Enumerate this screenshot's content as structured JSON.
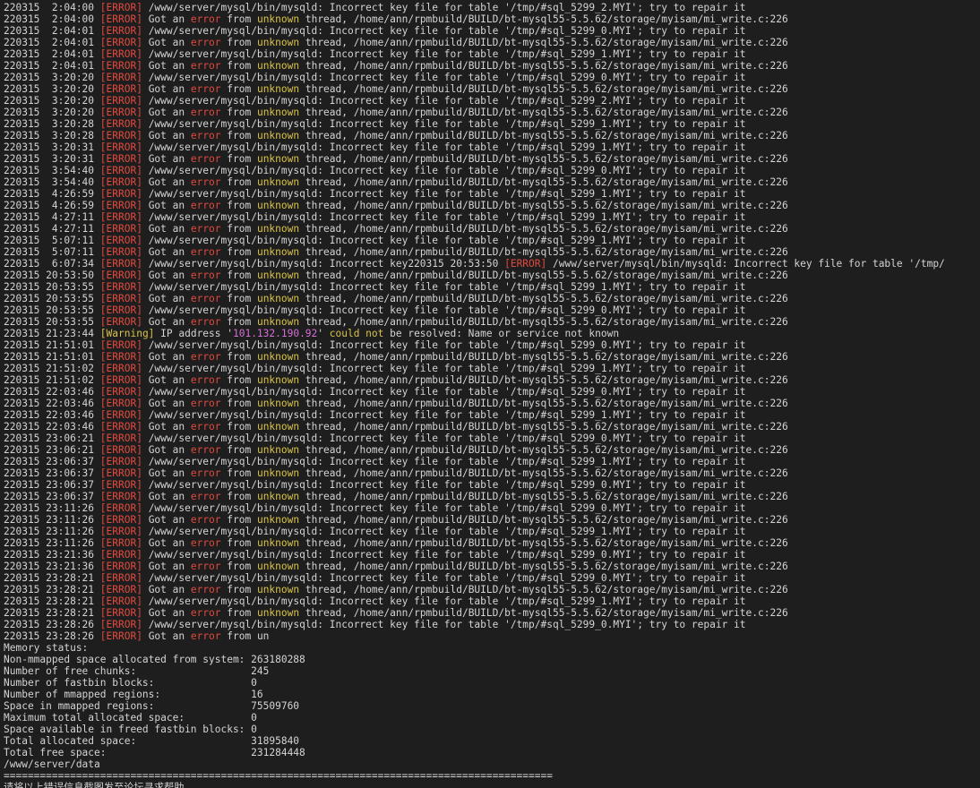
{
  "terminal": {
    "lines": [
      {
        "k": "inc",
        "ts": "220315  2:04:00",
        "tbl": "2"
      },
      {
        "k": "got",
        "ts": "220315  2:04:00"
      },
      {
        "k": "inc",
        "ts": "220315  2:04:01",
        "tbl": "0"
      },
      {
        "k": "got",
        "ts": "220315  2:04:01"
      },
      {
        "k": "inc",
        "ts": "220315  2:04:01",
        "tbl": "1"
      },
      {
        "k": "got",
        "ts": "220315  2:04:01"
      },
      {
        "k": "inc",
        "ts": "220315  3:20:20",
        "tbl": "0"
      },
      {
        "k": "got",
        "ts": "220315  3:20:20"
      },
      {
        "k": "inc",
        "ts": "220315  3:20:20",
        "tbl": "2"
      },
      {
        "k": "got",
        "ts": "220315  3:20:20"
      },
      {
        "k": "inc",
        "ts": "220315  3:20:28",
        "tbl": "1"
      },
      {
        "k": "got",
        "ts": "220315  3:20:28"
      },
      {
        "k": "inc",
        "ts": "220315  3:20:31",
        "tbl": "1"
      },
      {
        "k": "got",
        "ts": "220315  3:20:31"
      },
      {
        "k": "inc",
        "ts": "220315  3:54:40",
        "tbl": "0"
      },
      {
        "k": "got",
        "ts": "220315  3:54:40"
      },
      {
        "k": "inc",
        "ts": "220315  4:26:59",
        "tbl": "1"
      },
      {
        "k": "got",
        "ts": "220315  4:26:59"
      },
      {
        "k": "inc",
        "ts": "220315  4:27:11",
        "tbl": "1"
      },
      {
        "k": "got",
        "ts": "220315  4:27:11"
      },
      {
        "k": "inc",
        "ts": "220315  5:07:11",
        "tbl": "1"
      },
      {
        "k": "got",
        "ts": "220315  5:07:11"
      },
      {
        "k": "trunc",
        "ts": "220315  6:07:34"
      },
      {
        "k": "got",
        "ts": "220315 20:53:50"
      },
      {
        "k": "inc",
        "ts": "220315 20:53:55",
        "tbl": "1"
      },
      {
        "k": "got",
        "ts": "220315 20:53:55"
      },
      {
        "k": "inc",
        "ts": "220315 20:53:55",
        "tbl": "0"
      },
      {
        "k": "got",
        "ts": "220315 20:53:55"
      },
      {
        "k": "warn",
        "ts": "220315 21:23:44"
      },
      {
        "k": "inc",
        "ts": "220315 21:51:01",
        "tbl": "0"
      },
      {
        "k": "got",
        "ts": "220315 21:51:01"
      },
      {
        "k": "inc",
        "ts": "220315 21:51:02",
        "tbl": "1"
      },
      {
        "k": "got",
        "ts": "220315 21:51:02"
      },
      {
        "k": "inc",
        "ts": "220315 22:03:46",
        "tbl": "0"
      },
      {
        "k": "got",
        "ts": "220315 22:03:46"
      },
      {
        "k": "inc",
        "ts": "220315 22:03:46",
        "tbl": "1"
      },
      {
        "k": "got",
        "ts": "220315 22:03:46"
      },
      {
        "k": "inc",
        "ts": "220315 23:06:21",
        "tbl": "0"
      },
      {
        "k": "got",
        "ts": "220315 23:06:21"
      },
      {
        "k": "inc",
        "ts": "220315 23:06:37",
        "tbl": "1"
      },
      {
        "k": "got",
        "ts": "220315 23:06:37"
      },
      {
        "k": "inc",
        "ts": "220315 23:06:37",
        "tbl": "0"
      },
      {
        "k": "got",
        "ts": "220315 23:06:37"
      },
      {
        "k": "inc",
        "ts": "220315 23:11:26",
        "tbl": "0"
      },
      {
        "k": "got",
        "ts": "220315 23:11:26"
      },
      {
        "k": "inc",
        "ts": "220315 23:11:26",
        "tbl": "1"
      },
      {
        "k": "got",
        "ts": "220315 23:11:26"
      },
      {
        "k": "inc",
        "ts": "220315 23:21:36",
        "tbl": "0"
      },
      {
        "k": "got",
        "ts": "220315 23:21:36"
      },
      {
        "k": "inc",
        "ts": "220315 23:28:21",
        "tbl": "0"
      },
      {
        "k": "got",
        "ts": "220315 23:28:21"
      },
      {
        "k": "inc",
        "ts": "220315 23:28:21",
        "tbl": "1"
      },
      {
        "k": "got",
        "ts": "220315 23:28:21"
      },
      {
        "k": "inc",
        "ts": "220315 23:28:26",
        "tbl": "0"
      },
      {
        "k": "gotshort",
        "ts": "220315 23:28:26"
      },
      {
        "k": "plain",
        "text": "Memory status:"
      },
      {
        "k": "plain",
        "text": "Non-mmapped space allocated from system: 263180288"
      },
      {
        "k": "plain",
        "text": "Number of free chunks:                   245"
      },
      {
        "k": "plain",
        "text": "Number of fastbin blocks:                0"
      },
      {
        "k": "plain",
        "text": "Number of mmapped regions:               16"
      },
      {
        "k": "plain",
        "text": "Space in mmapped regions:                75509760"
      },
      {
        "k": "plain",
        "text": "Maximum total allocated space:           0"
      },
      {
        "k": "plain",
        "text": "Space available in freed fastbin blocks: 0"
      },
      {
        "k": "plain",
        "text": "Total allocated space:                   31895840"
      },
      {
        "k": "plain",
        "text": "Total free space:                        231284448"
      },
      {
        "k": "plain",
        "text": "/www/server/data"
      },
      {
        "k": "plain",
        "text": "==========================================================================================="
      },
      {
        "k": "plain",
        "text": "请将以上错误信息截图发至论坛寻求帮助"
      }
    ],
    "strings": {
      "error_tag": "[ERROR]",
      "warning_tag": "[Warning]",
      "inc_pre": " /www/server/mysql/bin/mysqld: Incorrect key file for table '/tmp/#sql_5299_",
      "inc_post": ".MYI'; try to repair it",
      "got_pre": " Got an ",
      "got_error": "error",
      "got_mid": " from ",
      "got_unknown": "unknown",
      "got_post": " thread, /home/ann/rpmbuild/BUILD/bt-mysql55-5.5.62/storage/myisam/mi_write.c:226",
      "trunc_text": " /www/server/mysql/bin/mysqld: Incorrect key220315 20:53:50 ",
      "trunc_tail": " /www/server/mysql/bin/mysqld: Incorrect key file for table '/tmp/",
      "warn_pre": " IP address '",
      "warn_ip": "101.132.190.92",
      "warn_mid": "' ",
      "warn_couldnot": "could not",
      "warn_post": " be resolved: Name or service not known",
      "gotshort_pre": " Got an ",
      "gotshort_post": " from un"
    },
    "colors": {
      "background": "#1e1e1e",
      "text": "#d4d4d4",
      "error": "#e04a3f",
      "warning": "#d9c34a",
      "ip": "#d670d6"
    }
  }
}
